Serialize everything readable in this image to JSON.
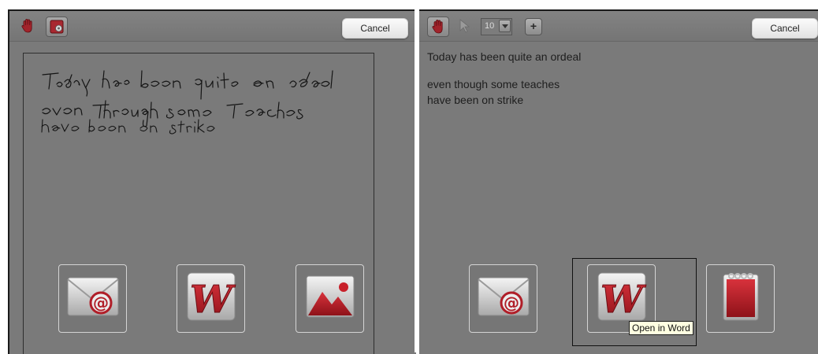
{
  "left_panel": {
    "toolbar": {
      "cancel_label": "Cancel",
      "icons": [
        "hand-icon",
        "lasso-settings-icon"
      ]
    },
    "handwriting_lines": [
      "Today has been quite an ordeal",
      "even though Some teaches",
      "have been on strike"
    ],
    "actions": [
      "email-icon",
      "word-icon",
      "image-icon"
    ]
  },
  "right_panel": {
    "toolbar": {
      "cancel_label": "Cancel",
      "font_size": "10",
      "icons": [
        "hand-icon",
        "pointer-icon",
        "chevron-down-icon",
        "plus-icon"
      ]
    },
    "converted_text": {
      "line1": "Today has been quite an ordeal",
      "line2": "even though some teaches",
      "line3": "have been on strike"
    },
    "actions": [
      "email-icon",
      "word-icon",
      "notepad-icon"
    ],
    "tooltip": "Open in Word"
  },
  "colors": {
    "panel_bg": "#7a7a7a",
    "accent_red": "#b8202a",
    "button_border": "#d4d4d4"
  }
}
